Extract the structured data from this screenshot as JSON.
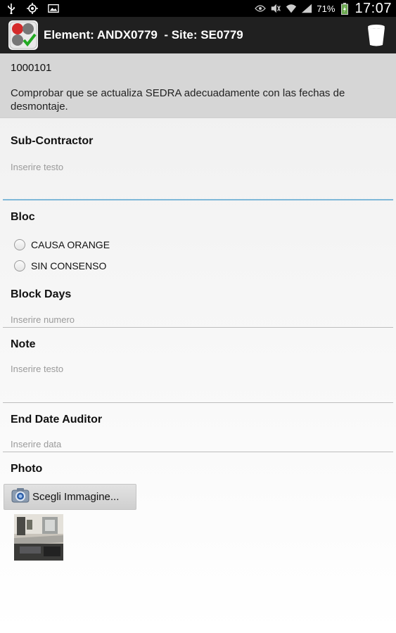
{
  "status_bar": {
    "battery_percent": "71%",
    "time": "17:07",
    "icons": [
      "usb-icon",
      "gps-icon",
      "image-icon",
      "eye-icon",
      "mute-icon",
      "wifi-icon",
      "signal-icon",
      "battery-icon"
    ]
  },
  "action_bar": {
    "title": "Element: ANDX0779  - Site: SE0779",
    "icons": [
      "app-logo-icon",
      "delete-icon"
    ]
  },
  "header": {
    "code": "1000101",
    "description": "Comprobar que se actualiza SEDRA adecuadamente con las fechas de desmontaje."
  },
  "form": {
    "subcontractor": {
      "label": "Sub-Contractor",
      "placeholder": "Inserire testo"
    },
    "bloc": {
      "label": "Bloc",
      "options": [
        {
          "label": "CAUSA ORANGE",
          "checked": false
        },
        {
          "label": "SIN CONSENSO",
          "checked": false
        }
      ]
    },
    "block_days": {
      "label": "Block Days",
      "placeholder": "Inserire numero"
    },
    "note": {
      "label": "Note",
      "placeholder": "Inserire testo"
    },
    "end_date_auditor": {
      "label": "End Date Auditor",
      "placeholder": "Inserire data"
    },
    "photo": {
      "label": "Photo",
      "button_label": "Scegli Immagine..."
    }
  },
  "colors": {
    "status_bar": "#000000",
    "action_bar": "#202020",
    "header_bg": "#d6d6d6",
    "active_field_line": "#7fb8d8"
  }
}
